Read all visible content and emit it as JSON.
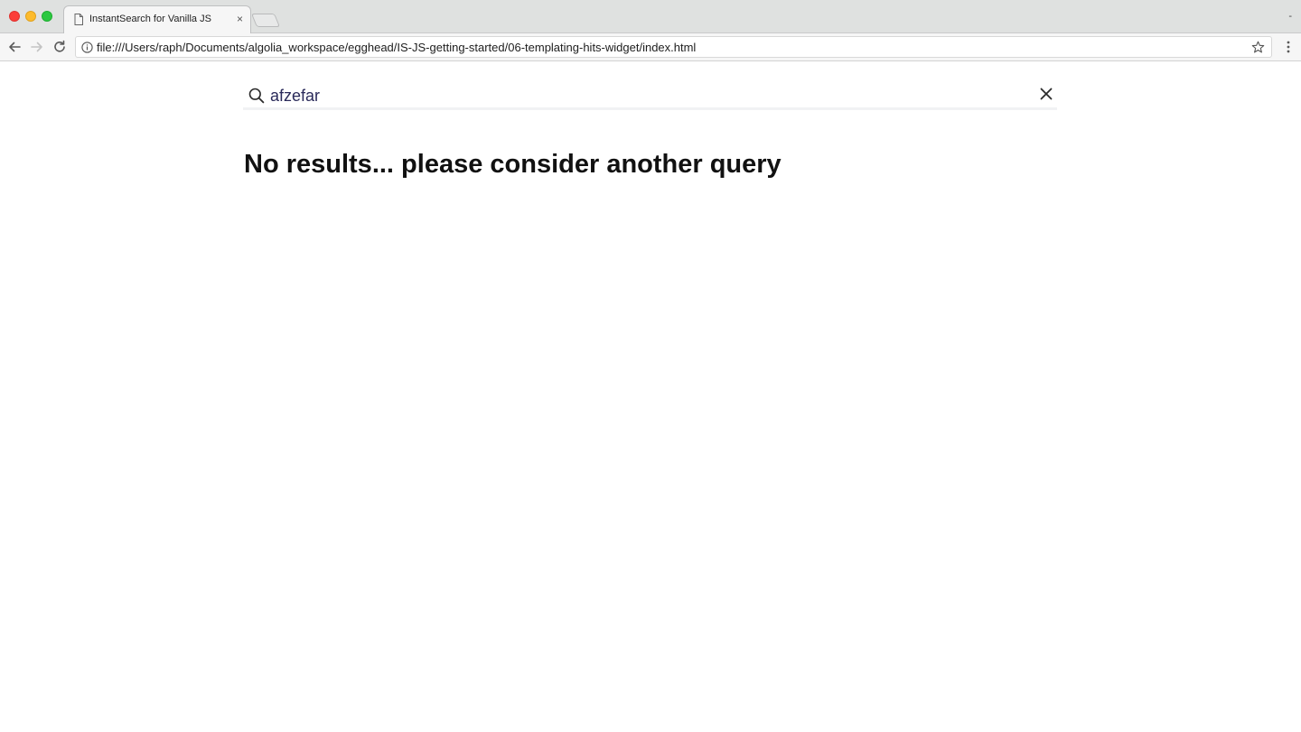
{
  "browser": {
    "tab": {
      "title": "InstantSearch for Vanilla JS",
      "close_glyph": "×",
      "icon": "document-icon"
    },
    "profile_glyph": "-",
    "address_bar": {
      "url": "file:///Users/raph/Documents/algolia_workspace/egghead/IS-JS-getting-started/06-templating-hits-widget/index.html",
      "icon": "info-icon"
    },
    "colors": {
      "close": "#fc3d39",
      "minimize": "#fdbb2d",
      "maximize": "#2bc840"
    }
  },
  "search": {
    "query": "afzefar",
    "icon": "search-icon",
    "reset_icon": "close-icon"
  },
  "results": {
    "empty_message": "No results... please consider another query"
  }
}
